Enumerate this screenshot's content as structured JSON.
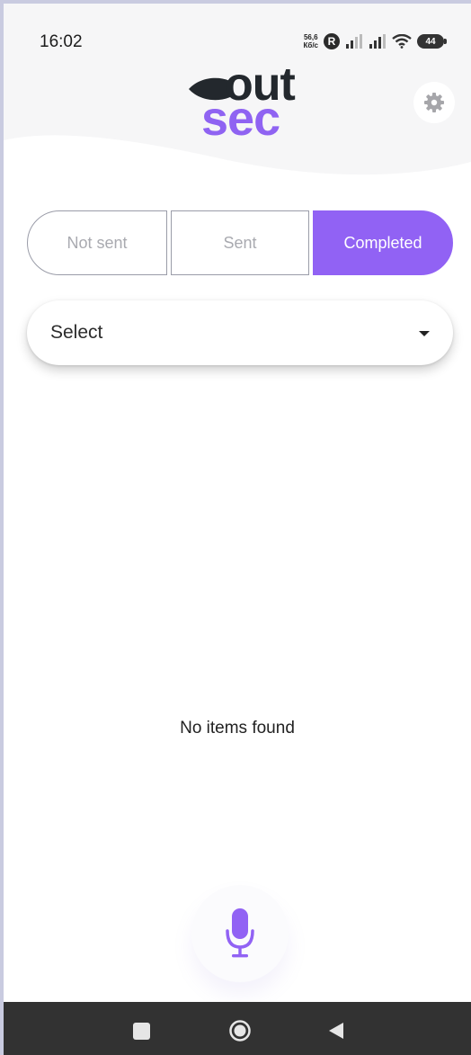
{
  "status_bar": {
    "time": "16:02",
    "net_speed_top": "56,6",
    "net_speed_bottom": "Кб/с",
    "r_badge": "R",
    "battery": "44",
    "icons": [
      "signal-icon",
      "signal-icon",
      "wifi-icon",
      "battery-icon"
    ]
  },
  "logo": {
    "line1": "out",
    "line2": "sec",
    "colors": {
      "dark": "#23282d",
      "accent": "#8f63f2"
    }
  },
  "header": {
    "settings_icon": "gear-icon"
  },
  "tabs": [
    {
      "label": "Not sent",
      "selected": false
    },
    {
      "label": "Sent",
      "selected": false
    },
    {
      "label": "Completed",
      "selected": true
    }
  ],
  "select": {
    "value": "Select",
    "icon": "dropdown-caret-icon"
  },
  "empty_state": {
    "text": "No items found"
  },
  "mic": {
    "icon": "microphone-icon",
    "color": "#9162f4"
  },
  "nav_bar": {
    "icons": [
      "recents-square-icon",
      "home-circle-icon",
      "back-triangle-icon"
    ]
  },
  "theme": {
    "accent": "#9162f4",
    "background": "#ffffff",
    "header_bg": "#f6f6f7"
  }
}
